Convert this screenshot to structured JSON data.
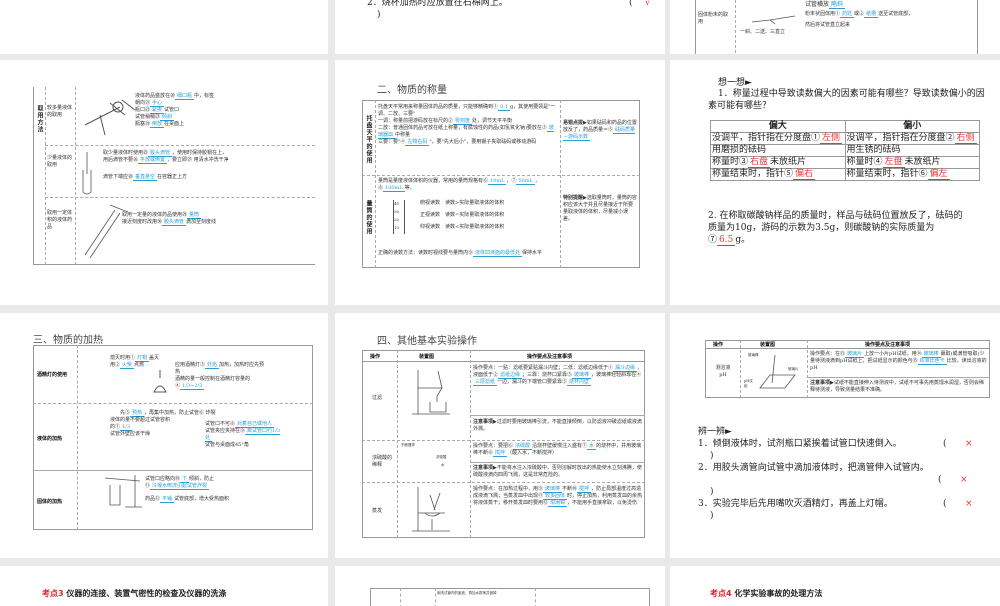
{
  "top_middle": {
    "item": "2．烧杯加热时应放置在石棉网上。",
    "paren_open": "(",
    "mark": "√",
    "paren_close": ")"
  },
  "top_right": {
    "row_label": "固体粉末的取用",
    "line1": "试管横放",
    "line1_ans": "略斜",
    "line2a": "粉末状固体用①",
    "ans_a": "药匙",
    "line2b": "或②",
    "ans_b": "纸槽",
    "line2c": "送至试管底部，",
    "line3": "然后将试管直立起来",
    "note": "一斜、二送、三直立"
  },
  "liquid": {
    "side_label": "取用方法",
    "rows": [
      {
        "label": "较多量液体的取用",
        "lines": [
          [
            "液体药品盛放在⑳",
            "细口瓶",
            "中，标签"
          ],
          [
            "朝向㉑",
            "手心",
            ""
          ],
          [
            "瓶口㉒",
            "紧挨",
            "试管口"
          ],
          [
            "试管稍稍㉓",
            "倾斜",
            ""
          ],
          [
            "瓶塞㉔",
            "倒放",
            "在桌面上"
          ]
        ]
      },
      {
        "label": "少量液体的取用",
        "lines": [
          [
            "取少量液体时使用㉕",
            "胶头滴管",
            "，使用时保持胶帽在上，"
          ],
          [
            "用后滴管不要㉖",
            "平放或倒置",
            "，要立即㉗ 用清水冲洗干净"
          ],
          [
            "滴管下端应㉘",
            "垂直悬空",
            "在容器正上方"
          ]
        ]
      },
      {
        "label": "取用一定体积的液体药品",
        "lines": [
          [
            "取用一定量的液体药品使用㉙",
            "量筒",
            ""
          ],
          [
            "接近刻度时改用㉚",
            "胶头滴管",
            "滴加至刻度线"
          ]
        ]
      }
    ]
  },
  "weighing": {
    "title": "二、物质的称量",
    "balance": {
      "label": "托盘天平的使用",
      "p1a": "托盘天平常用来称量固体药品的质量，只能够精确到①",
      "a1": "0.1",
      "p1b": "g，其使用要领是\"一调、二放、三要\"",
      "p2a": "一调：称量前把游码放在标尺的②",
      "a2": "零刻度",
      "p2b": "处，调节天平平衡",
      "p3": "二放：普通固体药品可放在纸上称量，有腐蚀性的药品(如氢氧化钠)要放在③",
      "a3": "玻璃器皿",
      "p3b": "中称量",
      "p4a": "三要：要\"④",
      "a4": "左物右码",
      "p4b": "\"，要\"先大后小\"，要用镊子夹取砝码或移动游码",
      "tip_title": "易错点拨",
      "tip_a": "如果砝码和药品的位置放反了，药品质量＝⑤",
      "tip_ans": "砝码质量－游码示数"
    },
    "cylinder": {
      "label": "量筒的使用",
      "p1": "量筒是量度液体体积的仪器，常用的量筒规格有⑥",
      "a6": "10mL",
      "a7": "50mL",
      "a8": "100mL",
      "p1b": "等。",
      "views": [
        "俯视读数　读数>实际量取液体的体积",
        "正视读数　读数=实际量取液体的体积",
        "仰视读数　读数<实际量取液体的体积"
      ],
      "ticks": [
        "40",
        "30",
        "20",
        "10"
      ],
      "p2": "正确的读数方法：读数时视线要与量筒内⑨",
      "a9": "液体凹液面的最低处",
      "p2b": "保持水平",
      "tip_title": "特别提醒",
      "tip": "选取量筒时，量筒的容积应该大于并且尽量接近于所要量取液体的体积，尽量减小误差。"
    }
  },
  "think": {
    "heading": "想一想►",
    "q1": "1．称量过程中导致读数偏大的因素可能有哪些？导致读数偏小的因素可能有哪些？",
    "headers": [
      "偏大",
      "偏小"
    ],
    "rows": [
      [
        "没调平，指针指在分度盘①",
        "左侧",
        "没调平，指针指在分度盘②",
        "右侧"
      ],
      [
        "用磨损的砝码",
        "",
        "用生锈的砝码",
        ""
      ],
      [
        "称量时③",
        "右盘",
        "称量时④",
        "左盘"
      ],
      [
        "称量结束时，指针⑤",
        "偏右",
        "称量结束时，指针⑥",
        "偏左"
      ]
    ],
    "suffix3": "未放纸片",
    "suffix4": "未放纸片",
    "q2a": "2. 在称取碳酸钠样品的质量时，样品与砝码位置放反了，砝码的质量为10g，游码的示数为3.5g，则碳酸钠的实际质量为⑦",
    "q2ans": "6.5",
    "q2b": "g。"
  },
  "heating": {
    "title": "三、物质的加热",
    "rows": [
      {
        "label": "酒精灯的使用",
        "lines": [
          [
            "熄灭时用①",
            "灯帽",
            "盖灭"
          ],
          [
            "用②",
            "火柴",
            "点燃"
          ],
          [
            "应用酒精灯③",
            "外焰",
            "加热，加热时应先预热"
          ],
          [
            "酒精的量一般控制在酒精灯容量的④",
            "1/3~2/3",
            ""
          ]
        ]
      },
      {
        "label": "液体的加热",
        "lines": [
          [
            "先⑤",
            "预热",
            "，再集中加热，防止试管⑥ 炸裂"
          ],
          [
            "液体的量不要超过试管容积的⑦",
            "1/3",
            ""
          ],
          [
            "试管口不可⑧",
            "对着自己或他人",
            ""
          ],
          [
            "试管夹应夹持在⑨",
            "离试管口约1/3处",
            ""
          ],
          [
            "试管外壁应该干燥",
            "",
            ""
          ],
          [
            "试管与桌面成45°角",
            "",
            ""
          ]
        ]
      },
      {
        "label": "固体的加热",
        "lines": [
          [
            "试管口应略向⑩",
            "下",
            "倾斜，防止"
          ],
          [
            "⑪",
            "冷凝水倒流引起试管炸裂",
            ""
          ],
          [
            "药品⑫",
            "平铺",
            "试管底部，增大受热面积"
          ]
        ]
      }
    ]
  },
  "other_ops": {
    "title": "四、其他基本实验操作",
    "headers": [
      "操作",
      "装置图",
      "操作要点及注意事项"
    ],
    "filter": {
      "label": "过滤",
      "p": "操作要点：一贴：滤纸要紧贴漏斗内壁；二低：滤纸边缘低于①",
      "a1": "漏斗边缘",
      "p2": "，液面低于②",
      "a2": "滤纸边缘",
      "p3": "；三靠：烧杯口紧靠③",
      "a3": "玻璃棒",
      "p4": "，玻璃棒轻轻斜靠在④",
      "a4": "三层滤纸",
      "p5": "一边，漏斗的下端管口要紧靠⑤",
      "a5": "烧杯内壁",
      "note_title": "注意事项",
      "note": "过滤时要用玻璃棒引流，不能直接倾倒，以防滤液冲破滤纸或液滴外溅。"
    },
    "dilute": {
      "label": "浓硫酸的稀释",
      "fig_labels": [
        "不断搅拌",
        "浓硫酸",
        "水"
      ],
      "p": "操作要点：要把⑥",
      "a6": "浓硫酸",
      "p2": "沿烧杯壁缓慢注入盛有⑦",
      "a7": "水",
      "p3": "的烧杯中，并用玻璃棒不断⑧",
      "a8": "搅拌",
      "p4": "（酸入水，不断搅拌）",
      "note_title": "注意事项",
      "note": "不能将水注入浓硫酸中，否则溶解时放出的热能使水立刻沸腾，使硫酸液滴向四周飞溅，这是非常危险的。"
    },
    "evap": {
      "label": "蒸发",
      "p": "操作要点：在加热过程中，用⑨",
      "a9": "玻璃棒",
      "p2": "不断⑩",
      "a10": "搅拌",
      "p3": "，防止局部温度过高造成液滴飞溅；当蒸发皿中出现⑪",
      "a11": "较多固体",
      "p4": "时，停止加热，利用蒸发皿的余热将液体蒸干；移开蒸发皿时要用⑫",
      "a12": "坩埚钳",
      "p5": "，不能用手直接拿取，以免烫伤"
    }
  },
  "ph": {
    "headers": [
      "操作",
      "装置图",
      "操作要点及注意事项"
    ],
    "label": "测溶液pH",
    "fig_labels": [
      "玻璃棒",
      "pH试纸",
      "玻璃片"
    ],
    "p": "操作要点：在⑬",
    "a13": "玻璃片",
    "p2": "上放一小片pH试纸，用⑭",
    "a14": "玻璃棒",
    "p3": "蘸取(或滴管吸取)少量待测液滴到pH试纸上，把试纸显示的颜色与⑮",
    "a15": "标准比色卡",
    "p4": "比较，读出溶液的pH",
    "note_title": "注意事项",
    "note": "试纸不能直接伸入待测液中，试纸不可事先用蒸馏水润湿，否则会稀释待测液，导致测量结果不准确。"
  },
  "judge": {
    "heading": "辨一辨►",
    "items": [
      {
        "text": "1．倾倒液体时，试剂瓶口紧挨着试管口快速倒入。",
        "mark": "×"
      },
      {
        "text": "2．用胶头滴管向试管中滴加液体时，把滴管伸入试管内。",
        "mark": "×"
      },
      {
        "text": "3．实验完毕后先用嘴吹灭酒精灯，再盖上灯帽。",
        "mark": "×"
      }
    ],
    "paren_open": "(",
    "paren_close": ")"
  },
  "bottom": {
    "left_tag": "考点3",
    "left_title": "仪器的连接、装置气密性的检查及仪器的洗涤",
    "mid_text": "倒洗试管内的废液，再加水振荡并倒掉",
    "right_tag": "考点4",
    "right_title": "化学实验事故的处理方法"
  },
  "colors": {
    "answer_blue": "#2a9fd6",
    "answer_red": "#e33",
    "tag_red": "#d9232d"
  }
}
